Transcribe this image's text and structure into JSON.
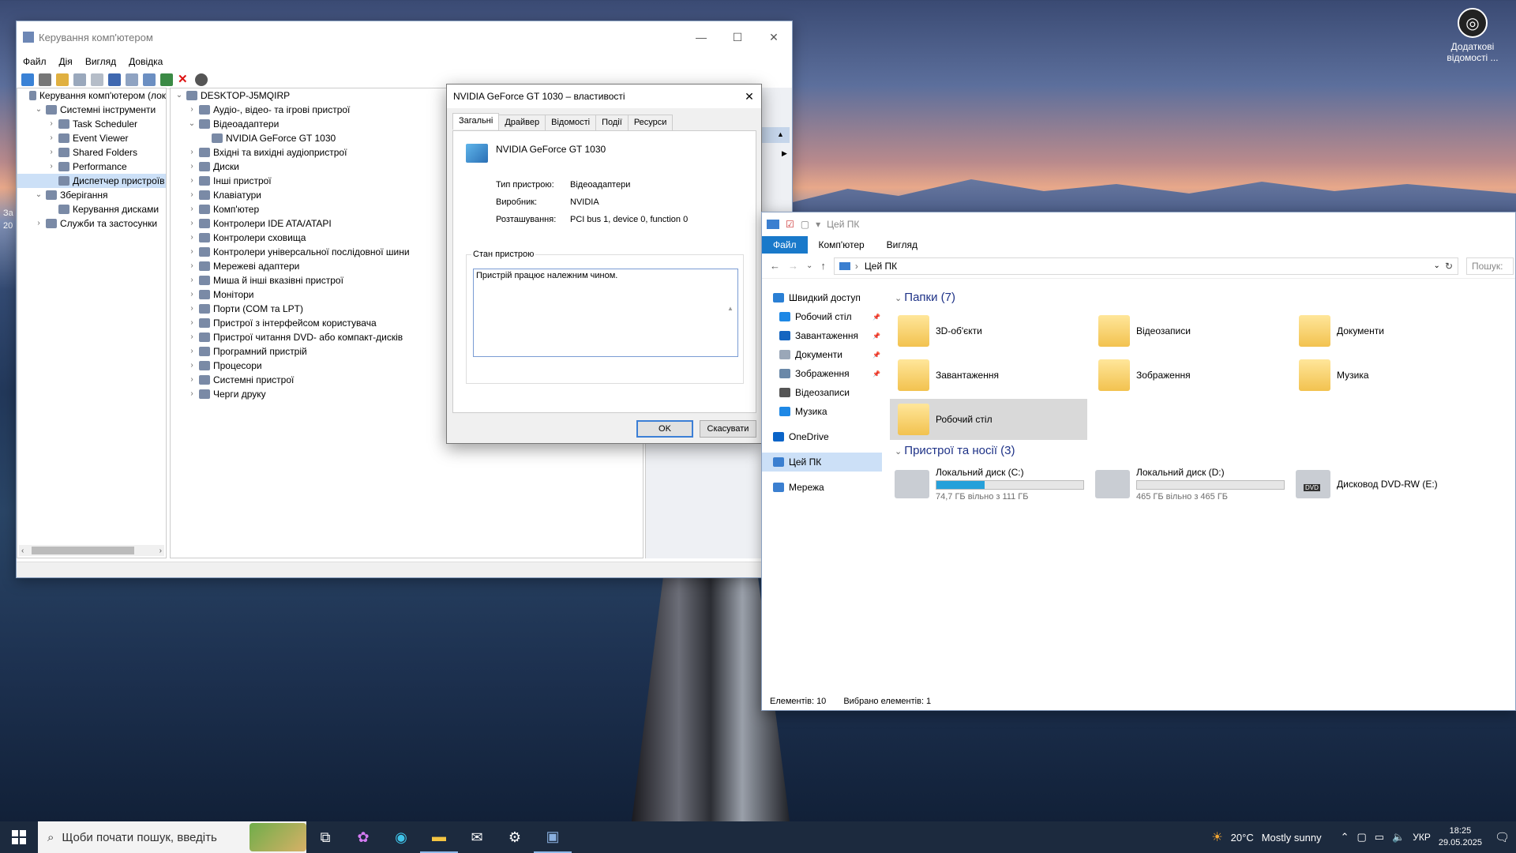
{
  "desktop": {
    "icon_label": "Додаткові відомості ...",
    "left_fragments": [
      "За",
      "20"
    ]
  },
  "cm": {
    "title": "Керування комп'ютером",
    "menu": [
      "Файл",
      "Дія",
      "Вигляд",
      "Довідка"
    ],
    "left_tree": [
      {
        "label": "Керування комп'ютером (лок",
        "level": 0,
        "exp": ""
      },
      {
        "label": "Системні інструменти",
        "level": 1,
        "exp": "v"
      },
      {
        "label": "Task Scheduler",
        "level": 2,
        "exp": ">"
      },
      {
        "label": "Event Viewer",
        "level": 2,
        "exp": ">"
      },
      {
        "label": "Shared Folders",
        "level": 2,
        "exp": ">"
      },
      {
        "label": "Performance",
        "level": 2,
        "exp": ">"
      },
      {
        "label": "Диспетчер пристроїв",
        "level": 2,
        "exp": "",
        "selected": true
      },
      {
        "label": "Зберігання",
        "level": 1,
        "exp": "v"
      },
      {
        "label": "Керування дисками",
        "level": 2,
        "exp": ""
      },
      {
        "label": "Служби та застосунки",
        "level": 1,
        "exp": ">"
      }
    ],
    "device_tree": [
      {
        "label": "DESKTOP-J5MQIRP",
        "level": 0,
        "exp": "v"
      },
      {
        "label": "Аудіо-, відео- та ігрові пристрої",
        "level": 1,
        "exp": ">"
      },
      {
        "label": "Відеоадаптери",
        "level": 1,
        "exp": "v"
      },
      {
        "label": "NVIDIA GeForce GT 1030",
        "level": 2,
        "exp": ""
      },
      {
        "label": "Вхідні та вихідні аудіопристрої",
        "level": 1,
        "exp": ">"
      },
      {
        "label": "Диски",
        "level": 1,
        "exp": ">"
      },
      {
        "label": "Інші пристрої",
        "level": 1,
        "exp": ">"
      },
      {
        "label": "Клавіатури",
        "level": 1,
        "exp": ">"
      },
      {
        "label": "Комп'ютер",
        "level": 1,
        "exp": ">"
      },
      {
        "label": "Контролери IDE ATA/ATAPI",
        "level": 1,
        "exp": ">"
      },
      {
        "label": "Контролери сховища",
        "level": 1,
        "exp": ">"
      },
      {
        "label": "Контролери універсальної послідовної шини",
        "level": 1,
        "exp": ">"
      },
      {
        "label": "Мережеві адаптери",
        "level": 1,
        "exp": ">"
      },
      {
        "label": "Миша й інші вказівні пристрої",
        "level": 1,
        "exp": ">"
      },
      {
        "label": "Монітори",
        "level": 1,
        "exp": ">"
      },
      {
        "label": "Порти (COM та LPT)",
        "level": 1,
        "exp": ">"
      },
      {
        "label": "Пристрої з інтерфейсом користувача",
        "level": 1,
        "exp": ">"
      },
      {
        "label": "Пристрої читання DVD- або компакт-дисків",
        "level": 1,
        "exp": ">"
      },
      {
        "label": "Програмний пристрій",
        "level": 1,
        "exp": ">"
      },
      {
        "label": "Процесори",
        "level": 1,
        "exp": ">"
      },
      {
        "label": "Системні пристрої",
        "level": 1,
        "exp": ">"
      },
      {
        "label": "Черги друку",
        "level": 1,
        "exp": ">"
      }
    ]
  },
  "dialog": {
    "title": "NVIDIA GeForce GT 1030 – властивості",
    "tabs": [
      "Загальні",
      "Драйвер",
      "Відомості",
      "Події",
      "Ресурси"
    ],
    "device_name": "NVIDIA GeForce GT 1030",
    "type_label": "Тип пристрою:",
    "type_value": "Відеоадаптери",
    "mfr_label": "Виробник:",
    "mfr_value": "NVIDIA",
    "loc_label": "Розташування:",
    "loc_value": "PCI bus 1, device 0, function 0",
    "status_legend": "Стан пристрою",
    "status_text": "Пристрій працює належним чином.",
    "ok": "OK",
    "cancel": "Скасувати"
  },
  "explorer": {
    "title": "Цей ПК",
    "ribbon": [
      "Файл",
      "Комп'ютер",
      "Вигляд"
    ],
    "address": "Цей ПК",
    "search_placeholder": "Пошук:",
    "nav": [
      {
        "label": "Швидкий доступ",
        "color": "#2a7fd4"
      },
      {
        "label": "Робочий стіл",
        "color": "#1e88e5",
        "pin": "📌"
      },
      {
        "label": "Завантаження",
        "color": "#1565c0",
        "pin": "📌"
      },
      {
        "label": "Документи",
        "color": "#9aa7b8",
        "pin": "📌"
      },
      {
        "label": "Зображення",
        "color": "#6a88a8",
        "pin": "📌"
      },
      {
        "label": "Відеозаписи",
        "color": "#555",
        "pin": ""
      },
      {
        "label": "Музика",
        "color": "#1e88e5",
        "pin": ""
      },
      {
        "label": "OneDrive",
        "color": "#0a64c8",
        "pin": ""
      },
      {
        "label": "Цей ПК",
        "color": "#3b7fd0",
        "pin": ""
      },
      {
        "label": "Мережа",
        "color": "#3b7fd0",
        "pin": ""
      }
    ],
    "folders_header": "Папки (7)",
    "folders": [
      "3D-об'єкти",
      "Відеозаписи",
      "Документи",
      "Завантаження",
      "Зображення",
      "Музика",
      "Робочий стіл"
    ],
    "devices_header": "Пристрої та носії (3)",
    "drives": [
      {
        "name": "Локальний диск (C:)",
        "free": "74,7 ГБ вільно з 111 ГБ",
        "used_fraction": 0.33
      },
      {
        "name": "Локальний диск (D:)",
        "free": "465 ГБ вільно з 465 ГБ",
        "used_fraction": 0.0
      },
      {
        "name": "Дисковод DVD-RW (E:)",
        "badge": "DVD"
      }
    ],
    "status_items": "Елементів: 10",
    "status_selected": "Вибрано елементів: 1"
  },
  "taskbar": {
    "search_placeholder": "Щоби почати пошук, введіть",
    "temp": "20°C",
    "weather": "Mostly sunny",
    "lang": "УКР",
    "time": "18:25",
    "date": "29.05.2025"
  }
}
